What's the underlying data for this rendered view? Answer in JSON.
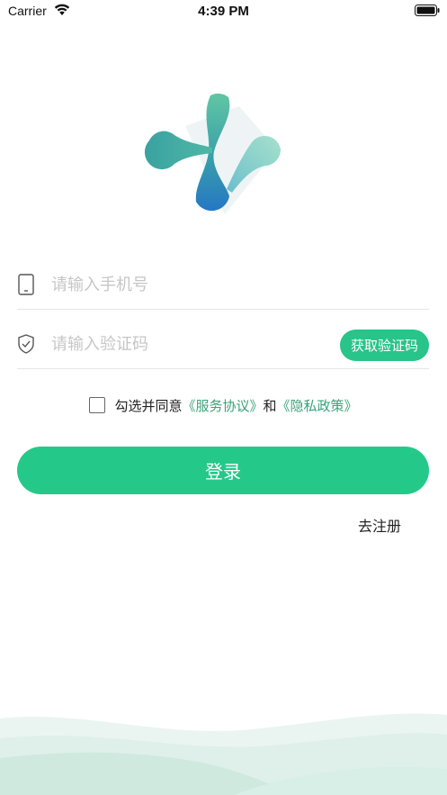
{
  "status_bar": {
    "carrier": "Carrier",
    "time": "4:39 PM"
  },
  "logo": {
    "icon": "app-logo-icon",
    "colors": [
      "#6fcfa8",
      "#3fa7a0",
      "#2f86c8",
      "#9ddcc6"
    ]
  },
  "phone_field": {
    "icon": "phone-icon",
    "placeholder": "请输入手机号",
    "value": ""
  },
  "code_field": {
    "icon": "shield-check-icon",
    "placeholder": "请输入验证码",
    "value": "",
    "get_code_label": "获取验证码"
  },
  "agreement": {
    "checked": false,
    "prefix": "勾选并同意",
    "terms_link": "《服务协议》",
    "and": "和",
    "privacy_link": "《隐私政策》"
  },
  "login_button": {
    "label": "登录"
  },
  "register_link": {
    "label": "去注册"
  },
  "colors": {
    "accent": "#24c989",
    "link": "#3aa27a",
    "placeholder": "#c6c6c6",
    "divider": "#e6e6e6"
  }
}
